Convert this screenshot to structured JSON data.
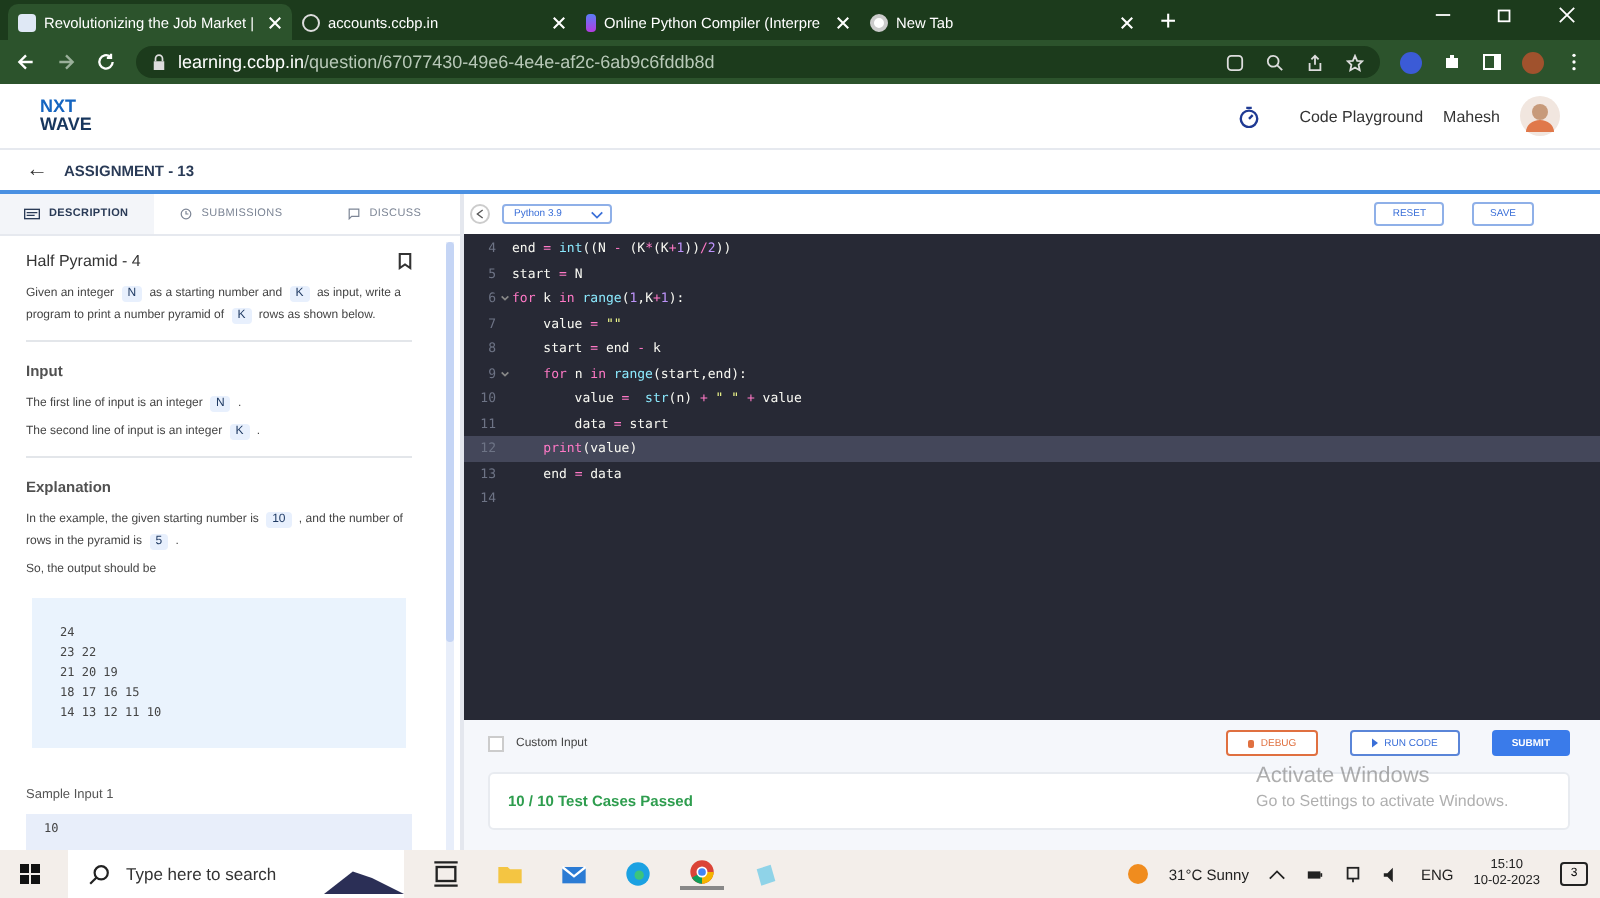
{
  "browser": {
    "tabs": [
      {
        "title": "Revolutionizing the Job Market |",
        "selected": true,
        "kind": "doc"
      },
      {
        "title": "accounts.ccbp.in",
        "selected": false,
        "kind": "globe"
      },
      {
        "title": "Online Python Compiler (Interpre",
        "selected": false,
        "kind": "logo"
      },
      {
        "title": "New Tab",
        "selected": false,
        "kind": "chrome"
      }
    ],
    "new_tab": "+",
    "url_host": "learning.ccbp.in",
    "url_path": "/question/67077430-49e6-4e4e-af2c-6ab9c6fddb8d"
  },
  "header": {
    "logo_top": "NXT",
    "logo_bottom": "WAVE",
    "nav_link": "Code Playground",
    "user": "Mahesh"
  },
  "assignment": {
    "back": "←",
    "title": "ASSIGNMENT - 13"
  },
  "left_tabs": [
    {
      "label": "DESCRIPTION",
      "selected": true,
      "kind": "desc"
    },
    {
      "label": "SUBMISSIONS",
      "selected": false,
      "kind": "clock"
    },
    {
      "label": "DISCUSS",
      "selected": false,
      "kind": "chat"
    }
  ],
  "problem": {
    "title": "Half Pyramid - 4",
    "intro": "Given an integer **N** as a starting number and **K** as input, write a program to print a number pyramid of **K** rows as shown below.",
    "sections": [
      {
        "heading": "Input",
        "lines": [
          "The first line of input is an integer **N** .",
          "The second line of input is an integer **K** ."
        ]
      },
      {
        "heading": "Explanation",
        "lines": [
          "In the example, the given starting number is **10** , and the number of rows in the pyramid is **5** .",
          "So, the output should be"
        ]
      }
    ],
    "output_lines": [
      "24",
      "23 22",
      "21 20 19",
      "18 17 16 15",
      "14 13 12 11 10"
    ],
    "sample_heading": "Sample Input 1",
    "sample_first": "10"
  },
  "editor": {
    "language": "Python 3.9",
    "reset": "RESET",
    "save": "SAVE",
    "lines": [
      {
        "no": "4",
        "fold": false,
        "active": false,
        "tokens": [
          {
            "text": "end ",
            "kind": "id"
          },
          {
            "text": "=",
            "kind": "op"
          },
          {
            "text": " int",
            "kind": "fn"
          },
          {
            "text": "((N ",
            "kind": "id"
          },
          {
            "text": "-",
            "kind": "op"
          },
          {
            "text": " (K",
            "kind": "id"
          },
          {
            "text": "*",
            "kind": "op"
          },
          {
            "text": "(K",
            "kind": "id"
          },
          {
            "text": "+",
            "kind": "op"
          },
          {
            "text": "1",
            "kind": "num"
          },
          {
            "text": "))",
            "kind": "id"
          },
          {
            "text": "/",
            "kind": "op"
          },
          {
            "text": "2",
            "kind": "num"
          },
          {
            "text": "))",
            "kind": "id"
          }
        ]
      },
      {
        "no": "5",
        "fold": false,
        "active": false,
        "tokens": [
          {
            "text": "start ",
            "kind": "id"
          },
          {
            "text": "=",
            "kind": "op"
          },
          {
            "text": " N",
            "kind": "id"
          }
        ]
      },
      {
        "no": "6",
        "fold": true,
        "active": false,
        "tokens": [
          {
            "text": "for",
            "kind": "kw"
          },
          {
            "text": " k ",
            "kind": "id"
          },
          {
            "text": "in",
            "kind": "kw"
          },
          {
            "text": " range",
            "kind": "fn"
          },
          {
            "text": "(",
            "kind": "id"
          },
          {
            "text": "1",
            "kind": "num"
          },
          {
            "text": ",K",
            "kind": "id"
          },
          {
            "text": "+",
            "kind": "op"
          },
          {
            "text": "1",
            "kind": "num"
          },
          {
            "text": "):",
            "kind": "id"
          }
        ]
      },
      {
        "no": "7",
        "fold": false,
        "active": false,
        "tokens": [
          {
            "text": "    value ",
            "kind": "id"
          },
          {
            "text": "=",
            "kind": "op"
          },
          {
            "text": " \"\"",
            "kind": "str"
          }
        ]
      },
      {
        "no": "8",
        "fold": false,
        "active": false,
        "tokens": [
          {
            "text": "    start ",
            "kind": "id"
          },
          {
            "text": "=",
            "kind": "op"
          },
          {
            "text": " end ",
            "kind": "id"
          },
          {
            "text": "-",
            "kind": "op"
          },
          {
            "text": " k",
            "kind": "id"
          }
        ]
      },
      {
        "no": "9",
        "fold": true,
        "active": false,
        "tokens": [
          {
            "text": "    for",
            "kind": "kw"
          },
          {
            "text": " n ",
            "kind": "id"
          },
          {
            "text": "in",
            "kind": "kw"
          },
          {
            "text": " range",
            "kind": "fn"
          },
          {
            "text": "(start,end):",
            "kind": "id"
          }
        ]
      },
      {
        "no": "10",
        "fold": false,
        "active": false,
        "tokens": [
          {
            "text": "        value ",
            "kind": "id"
          },
          {
            "text": "=",
            "kind": "op"
          },
          {
            "text": "  str",
            "kind": "fn"
          },
          {
            "text": "(n) ",
            "kind": "id"
          },
          {
            "text": "+",
            "kind": "op"
          },
          {
            "text": " \" \" ",
            "kind": "str"
          },
          {
            "text": "+",
            "kind": "op"
          },
          {
            "text": " value",
            "kind": "id"
          }
        ]
      },
      {
        "no": "11",
        "fold": false,
        "active": false,
        "tokens": [
          {
            "text": "        data ",
            "kind": "id"
          },
          {
            "text": "=",
            "kind": "op"
          },
          {
            "text": " start",
            "kind": "id"
          }
        ]
      },
      {
        "no": "12",
        "fold": false,
        "active": true,
        "tokens": [
          {
            "text": "    print",
            "kind": "kw"
          },
          {
            "text": "(value)",
            "kind": "id"
          }
        ]
      },
      {
        "no": "13",
        "fold": false,
        "active": false,
        "tokens": [
          {
            "text": "    end ",
            "kind": "id"
          },
          {
            "text": "=",
            "kind": "op"
          },
          {
            "text": " data",
            "kind": "id"
          }
        ]
      },
      {
        "no": "14",
        "fold": false,
        "active": false
      }
    ]
  },
  "custom_input": {
    "label": "Custom Input",
    "checked": false
  },
  "actions": {
    "debug": "DEBUG",
    "run": "RUN CODE",
    "submit": "SUBMIT"
  },
  "result": "10 / 10 Test Cases Passed",
  "activation": {
    "title": "Activate Windows",
    "hint": "Go to Settings to activate Windows."
  },
  "taskbar": {
    "search_placeholder": "Type here to search",
    "weather": "31°C  Sunny",
    "lang": "ENG",
    "time": "15:10",
    "date": "10-02-2023",
    "notifications": "3"
  }
}
